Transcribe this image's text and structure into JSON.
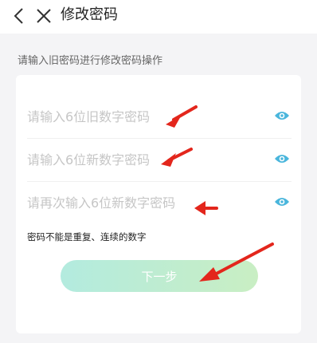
{
  "header": {
    "title": "修改密码"
  },
  "hint": "请输入旧密码进行修改密码操作",
  "form": {
    "old_placeholder": "请输入6位旧数字密码",
    "new_placeholder": "请输入6位新数字密码",
    "confirm_placeholder": "请再次输入6位新数字密码",
    "rule_text": "密码不能是重复、连续的数字",
    "next_label": "下一步"
  },
  "icons": {
    "back": "chevron-left-icon",
    "close": "close-icon",
    "eye": "eye-icon"
  },
  "colors": {
    "accent": "#4ab6dc",
    "button_gradient_start": "#b3ebdf",
    "button_gradient_end": "#c9eec3",
    "annotation_arrow": "#e3261c"
  }
}
